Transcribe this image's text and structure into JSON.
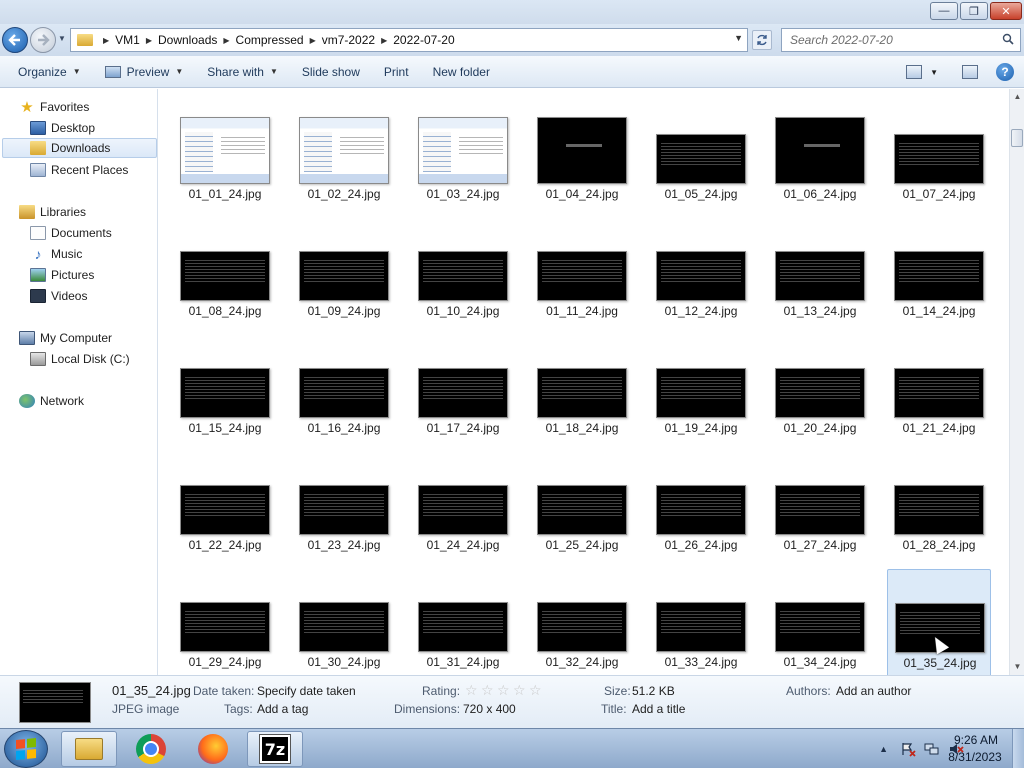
{
  "window": {
    "minimize_glyph": "—",
    "maximize_glyph": "❐",
    "close_glyph": "✕"
  },
  "address": {
    "crumbs": [
      "VM1",
      "Downloads",
      "Compressed",
      "vm7-2022",
      "2022-07-20"
    ],
    "separator": "▶",
    "dropdown_glyph": "▼"
  },
  "search": {
    "placeholder": "Search 2022-07-20"
  },
  "toolbar": {
    "organize": "Organize",
    "preview": "Preview",
    "share_with": "Share with",
    "slide_show": "Slide show",
    "print": "Print",
    "new_folder": "New folder",
    "caret": "▼",
    "help": "?"
  },
  "sidebar": {
    "favorites": "Favorites",
    "desktop": "Desktop",
    "downloads": "Downloads",
    "recent_places": "Recent Places",
    "libraries": "Libraries",
    "documents": "Documents",
    "music": "Music",
    "pictures": "Pictures",
    "videos": "Videos",
    "my_computer": "My Computer",
    "local_disk": "Local Disk (C:)",
    "network": "Network",
    "star_glyph": "★",
    "music_glyph": "♪"
  },
  "files": [
    {
      "name": "01_01_24.jpg",
      "kind": "desktopshot"
    },
    {
      "name": "01_02_24.jpg",
      "kind": "desktopshot"
    },
    {
      "name": "01_03_24.jpg",
      "kind": "desktopshot"
    },
    {
      "name": "01_04_24.jpg",
      "kind": "blackscreen"
    },
    {
      "name": "01_05_24.jpg",
      "kind": "console"
    },
    {
      "name": "01_06_24.jpg",
      "kind": "blackscreen"
    },
    {
      "name": "01_07_24.jpg",
      "kind": "console"
    },
    {
      "name": "01_08_24.jpg",
      "kind": "console"
    },
    {
      "name": "01_09_24.jpg",
      "kind": "console"
    },
    {
      "name": "01_10_24.jpg",
      "kind": "console"
    },
    {
      "name": "01_11_24.jpg",
      "kind": "console"
    },
    {
      "name": "01_12_24.jpg",
      "kind": "console"
    },
    {
      "name": "01_13_24.jpg",
      "kind": "console"
    },
    {
      "name": "01_14_24.jpg",
      "kind": "console"
    },
    {
      "name": "01_15_24.jpg",
      "kind": "console"
    },
    {
      "name": "01_16_24.jpg",
      "kind": "console"
    },
    {
      "name": "01_17_24.jpg",
      "kind": "console"
    },
    {
      "name": "01_18_24.jpg",
      "kind": "console"
    },
    {
      "name": "01_19_24.jpg",
      "kind": "console"
    },
    {
      "name": "01_20_24.jpg",
      "kind": "console"
    },
    {
      "name": "01_21_24.jpg",
      "kind": "console"
    },
    {
      "name": "01_22_24.jpg",
      "kind": "console"
    },
    {
      "name": "01_23_24.jpg",
      "kind": "console"
    },
    {
      "name": "01_24_24.jpg",
      "kind": "console"
    },
    {
      "name": "01_25_24.jpg",
      "kind": "console"
    },
    {
      "name": "01_26_24.jpg",
      "kind": "console"
    },
    {
      "name": "01_27_24.jpg",
      "kind": "console"
    },
    {
      "name": "01_28_24.jpg",
      "kind": "console"
    },
    {
      "name": "01_29_24.jpg",
      "kind": "console"
    },
    {
      "name": "01_30_24.jpg",
      "kind": "console"
    },
    {
      "name": "01_31_24.jpg",
      "kind": "console"
    },
    {
      "name": "01_32_24.jpg",
      "kind": "console"
    },
    {
      "name": "01_33_24.jpg",
      "kind": "console"
    },
    {
      "name": "01_34_24.jpg",
      "kind": "console"
    },
    {
      "name": "01_35_24.jpg",
      "kind": "console",
      "selected": true
    }
  ],
  "details": {
    "filename": "01_35_24.jpg",
    "filetype": "JPEG image",
    "date_taken_label": "Date taken:",
    "date_taken_value": "Specify date taken",
    "tags_label": "Tags:",
    "tags_value": "Add a tag",
    "rating_label": "Rating:",
    "rating_stars": 0,
    "star_glyph": "☆",
    "dimensions_label": "Dimensions:",
    "dimensions_value": "720 x 400",
    "size_label": "Size:",
    "size_value": "51.2 KB",
    "title_label": "Title:",
    "title_value": "Add a title",
    "authors_label": "Authors:",
    "authors_value": "Add an author"
  },
  "scrollbar": {
    "up_glyph": "▲",
    "down_glyph": "▼"
  },
  "taskbar": {
    "sevenz_label": "7z",
    "tray_up_glyph": "▲",
    "time": "9:26 AM",
    "date": "8/31/2023"
  },
  "colors": {
    "accent": "#1b5fae",
    "selection": "#dceaf8"
  }
}
